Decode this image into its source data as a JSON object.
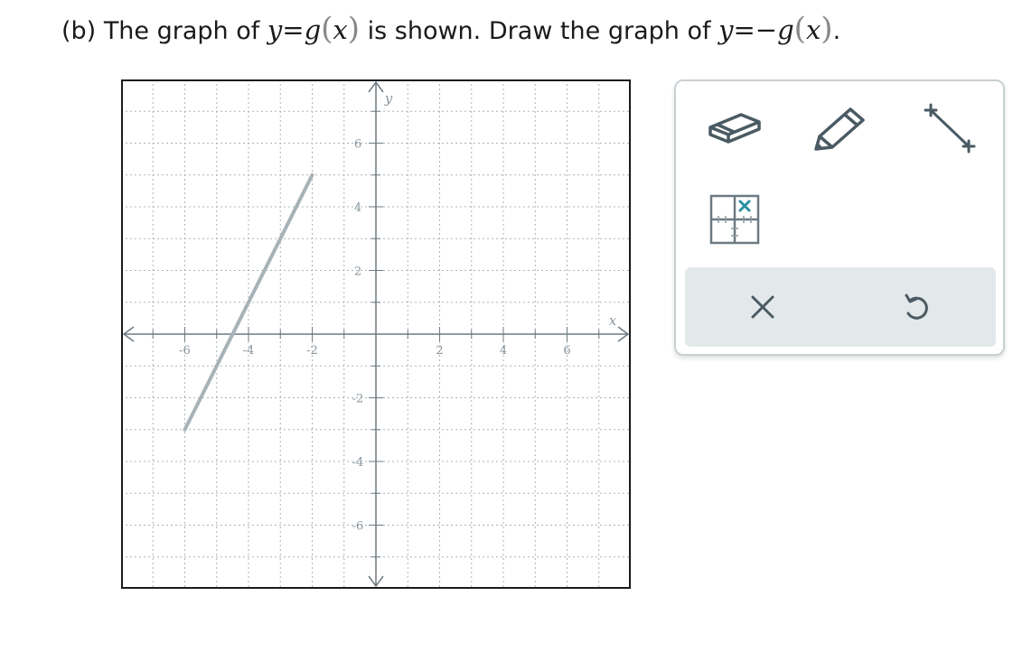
{
  "prompt": {
    "label": "(b)",
    "before": "The graph of",
    "given_function": {
      "lhs": "y",
      "eq": "=",
      "name": "g",
      "open": "(",
      "arg": "x",
      "close": ")"
    },
    "middle": "is shown. Draw the graph of",
    "target_function": {
      "lhs": "y",
      "eq": "=",
      "neg": "−",
      "name": "g",
      "open": "(",
      "arg": "x",
      "close": ")"
    },
    "end": "."
  },
  "graph": {
    "x_axis_label": "x",
    "y_axis_label": "y",
    "x_range": [
      -8,
      8
    ],
    "y_range": [
      -8,
      8
    ],
    "x_tick_labels": [
      "-6",
      "-4",
      "-2",
      "2",
      "4",
      "6"
    ],
    "y_tick_labels": [
      "6",
      "4",
      "2",
      "-2",
      "-4",
      "-6"
    ],
    "given_segment": {
      "start": [
        -6,
        -3
      ],
      "end": [
        -2,
        5
      ]
    },
    "colors": {
      "grid": "#a9b4ba",
      "axis": "#6e7a81",
      "segment": "#a7b2b8",
      "border": "#1a1a1a"
    }
  },
  "tools": [
    {
      "name": "eraser",
      "icon": "eraser-icon"
    },
    {
      "name": "pencil",
      "icon": "pencil-icon"
    },
    {
      "name": "line segment",
      "icon": "line-segment-icon"
    },
    {
      "name": "point",
      "icon": "point-grid-icon"
    }
  ],
  "actions": [
    {
      "name": "clear",
      "icon": "close-icon"
    },
    {
      "name": "undo",
      "icon": "undo-icon"
    }
  ],
  "colors": {
    "icon": "#4a5a63",
    "accent": "#2a8fa3",
    "action_bar": "#e3e8eb",
    "toolbox_border": "#c9d0d4"
  }
}
